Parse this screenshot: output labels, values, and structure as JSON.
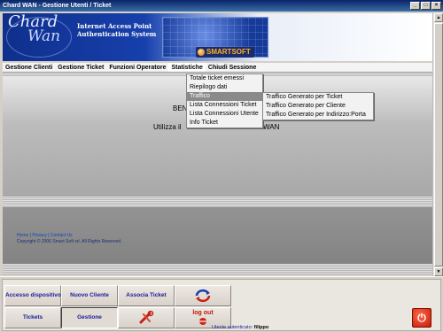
{
  "window": {
    "title": "Chard WAN - Gestione Utenti / Ticket"
  },
  "banner": {
    "logo_line1": "Chard",
    "logo_line2": "Wan",
    "tagline_line1": "Internet Access Point",
    "tagline_line2": "Authentication System",
    "brand": "SMARTSOFT"
  },
  "menu": {
    "items": [
      {
        "label": "Gestione Clienti"
      },
      {
        "label": "Gestione Ticket"
      },
      {
        "label": "Funzioni Operatore"
      },
      {
        "label": "Statistiche"
      },
      {
        "label": "Chiudi Sessione"
      }
    ]
  },
  "statistiche_menu": {
    "items": [
      {
        "label": "Totale ticket emessi"
      },
      {
        "label": "Riepilogo dati"
      },
      {
        "label": "Traffico"
      },
      {
        "label": "Lista Connessioni Ticket"
      },
      {
        "label": "Lista Connessioni Utente"
      },
      {
        "label": "Info Ticket"
      }
    ]
  },
  "traffico_submenu": {
    "items": [
      {
        "label": "Traffico Generato per Ticket"
      },
      {
        "label": "Traffico Generato per Cliente"
      },
      {
        "label": "Traffico Generato per Indirizzo:Porta"
      }
    ]
  },
  "content": {
    "welcome_partial": "BEN",
    "utilizza_left": "Utilizza il",
    "utilizza_right": "WAN"
  },
  "footer": {
    "links": [
      "Home",
      "Privacy",
      "Contact Us"
    ],
    "copyright": "Copyright © 2006 Smart Soft srl. All Rights Reserved."
  },
  "bottom": {
    "buttons": {
      "accesso": "Accesso dispositivo",
      "nuovo_cliente": "Nuovo Cliente",
      "associa_ticket": "Associa Ticket",
      "tickets": "Tickets",
      "gestione": "Gestione",
      "logout": "log out"
    },
    "user_label": "Utente autenticato:",
    "user_name": "filippo"
  },
  "colors": {
    "nav_text": "#1a1a9a",
    "menu_highlight": "#8a8a8a",
    "banner_blue": "#1a46b8"
  }
}
